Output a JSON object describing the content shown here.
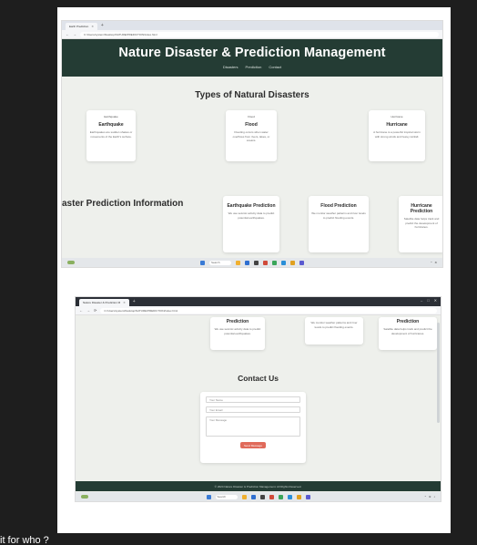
{
  "shot1": {
    "tab_label": "Earth Prediction",
    "url": "C:/Users/system/Desktop/NATURE/PREDICTION/index.html",
    "site_title": "Nature Disaster & Prediction Management",
    "nav": [
      "Disasters",
      "Prediction",
      "Contact"
    ],
    "types_title": "Types of Natural Disasters",
    "types_cards": [
      {
        "image_label": "Earthquake",
        "title": "Earthquake",
        "desc": "Earthquakes are sudden shakes or movements of the Earth's surface."
      },
      {
        "image_label": "Flood",
        "title": "Flood",
        "desc": "Flooding occurs when water overflows from rivers, lakes, or oceans."
      },
      {
        "image_label": "Hurricane",
        "title": "Hurricane",
        "desc": "A hurricane is a powerful tropical storm with strong winds and heavy rainfall."
      }
    ],
    "prediction_title": "aster Prediction Information",
    "prediction_cards": [
      {
        "title": "Earthquake Prediction",
        "desc": "We use seismic activity data to predict potential earthquakes."
      },
      {
        "title": "Flood Prediction",
        "desc": "We monitor weather patterns and river levels to predict flooding events."
      },
      {
        "title": "Hurricane Prediction",
        "desc": "Satellite data helps track and predict the development of hurricanes."
      }
    ],
    "taskbar_search": "Search"
  },
  "shot2": {
    "tab_label": "Nature Disaster & Prediction M",
    "url": "C:/Users/system/Desktop/NATURE/PREDICTION/index.html",
    "prediction_cards": [
      {
        "title": "Prediction",
        "desc": "We use seismic activity data to predict potential earthquakes."
      },
      {
        "title": "",
        "desc": "We monitor weather patterns and river levels to predict flooding events."
      },
      {
        "title": "Prediction",
        "desc": "Satellite data helps track and predict the development of hurricanes."
      }
    ],
    "contact_title": "Contact Us",
    "name_placeholder": "Your Name",
    "email_placeholder": "Your Email",
    "message_placeholder": "Your Message",
    "send_label": "Send Message",
    "footer_text": "© 2024 Nature Disaster & Prediction Management. All Rights Reserved.",
    "taskbar_search": "Search"
  },
  "caption": "it for who ?"
}
